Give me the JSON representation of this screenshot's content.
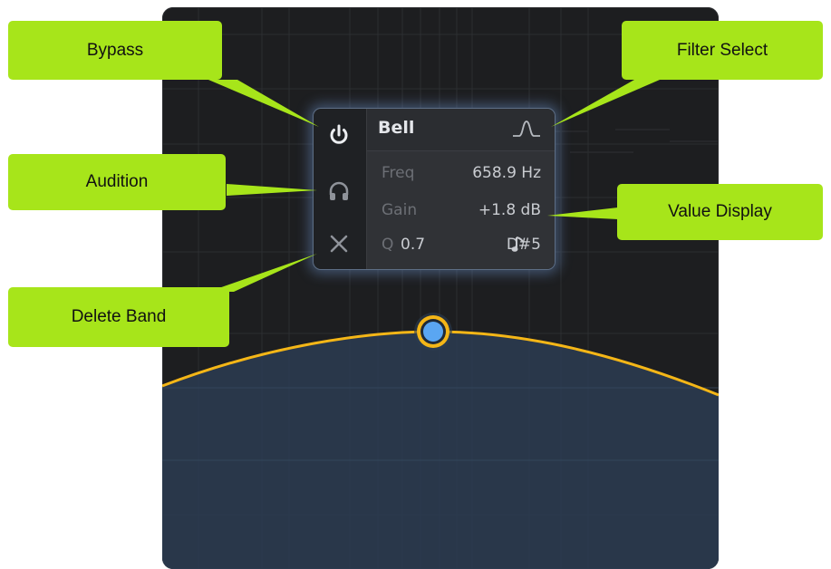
{
  "callouts": {
    "bypass": "Bypass",
    "audition": "Audition",
    "delete_band": "Delete Band",
    "filter_select": "Filter Select",
    "value_display": "Value Display"
  },
  "band_popup": {
    "filter_type": "Bell",
    "freq_label": "Freq",
    "freq_value": "658.9 Hz",
    "gain_label": "Gain",
    "gain_value": "+1.8 dB",
    "q_label": "Q",
    "q_value": "0.7",
    "note_value": "D#5"
  },
  "icons": {
    "bypass": "power-icon",
    "audition": "headphones-icon",
    "delete": "close-icon",
    "filter_shape": "bell-curve-icon",
    "note": "music-note-icon"
  },
  "colors": {
    "callout": "#a7e51a",
    "curve": "#f4b617",
    "node_fill": "#5aa6f2",
    "panel_bg": "#1d1e20"
  }
}
